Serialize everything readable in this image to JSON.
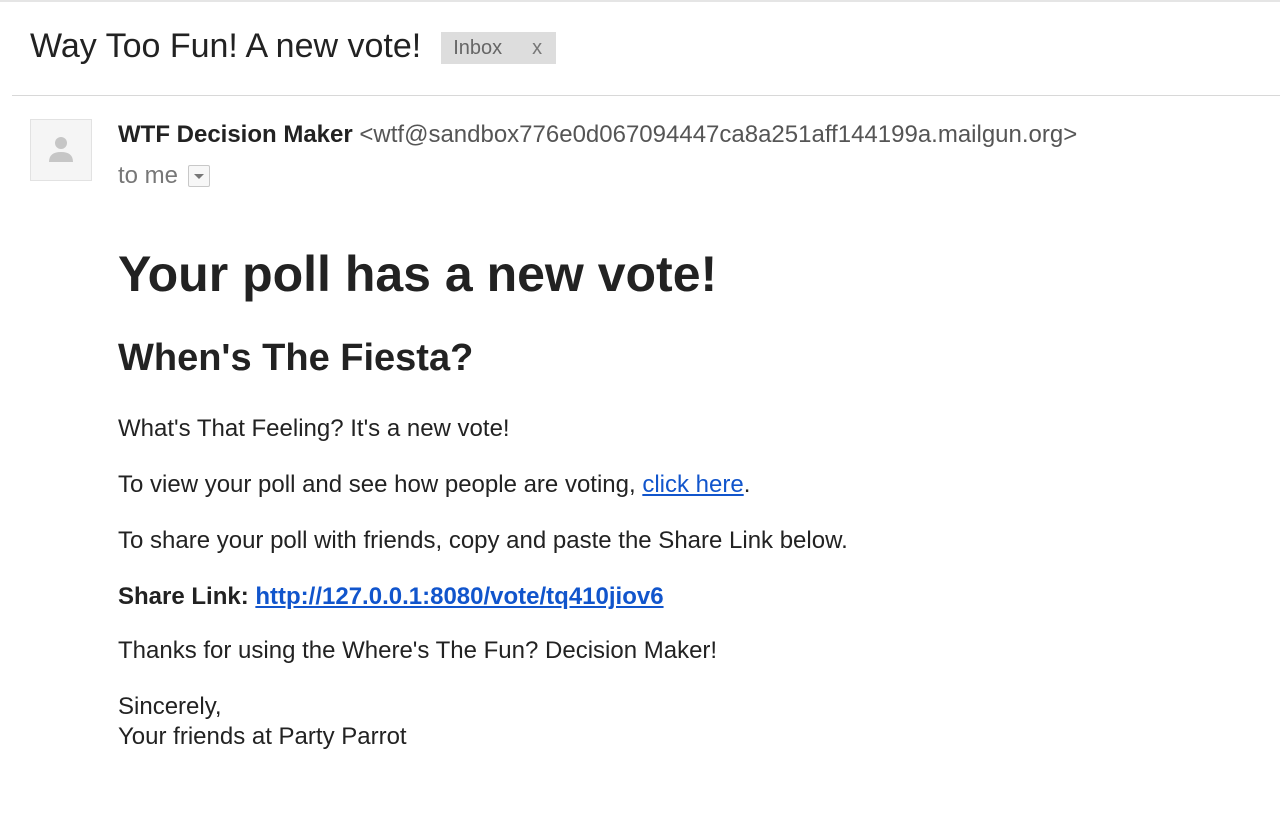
{
  "email": {
    "subject": "Way Too Fun! A new vote!",
    "label": {
      "name": "Inbox",
      "remove": "x"
    },
    "sender": {
      "name": "WTF Decision Maker",
      "address": "<wtf@sandbox776e0d067094447ca8a251aff144199a.mailgun.org>"
    },
    "recipient": "to me",
    "body": {
      "heading": "Your poll has a new vote!",
      "poll_title": "When's The Fiesta?",
      "intro": "What's That Feeling? It's a new vote!",
      "view_text": "To view your poll and see how people are voting, ",
      "view_link": "click here",
      "view_end": ".",
      "share_text": "To share your poll with friends, copy and paste the Share Link below.",
      "share_label": "Share Link:",
      "share_url": "http://127.0.0.1:8080/vote/tq410jiov6",
      "thanks": "Thanks for using the Where's The Fun? Decision Maker!",
      "signoff": "Sincerely,",
      "signature": "Your friends at Party Parrot"
    }
  },
  "colors": {
    "link": "#1155cc",
    "label_bg": "#dddddd",
    "text": "#222222"
  },
  "icons": {
    "avatar": "person-icon",
    "details": "caret-down-icon"
  }
}
